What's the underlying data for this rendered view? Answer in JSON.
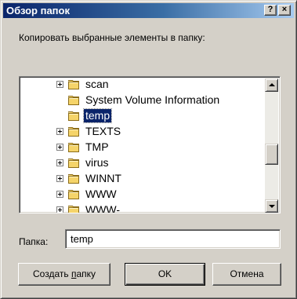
{
  "window": {
    "title": "Обзор папок",
    "help_label": "?",
    "close_label": "×"
  },
  "instruction": "Копировать выбранные элементы в папку:",
  "tree": {
    "items": [
      {
        "label": "scan",
        "has_children": true,
        "selected": false
      },
      {
        "label": "System Volume Information",
        "has_children": false,
        "selected": false
      },
      {
        "label": "temp",
        "has_children": false,
        "selected": true
      },
      {
        "label": "TEXTS",
        "has_children": true,
        "selected": false
      },
      {
        "label": "TMP",
        "has_children": true,
        "selected": false
      },
      {
        "label": "virus",
        "has_children": true,
        "selected": false
      },
      {
        "label": "WINNT",
        "has_children": true,
        "selected": false
      },
      {
        "label": "WWW",
        "has_children": true,
        "selected": false
      },
      {
        "label": "WWW-",
        "has_children": true,
        "selected": false
      }
    ],
    "scroll_position": 0.6
  },
  "folder_field": {
    "label": "Папка:",
    "value": "temp"
  },
  "buttons": {
    "create_prefix": "Создать ",
    "create_underlined": "п",
    "create_suffix": "апку",
    "ok": "OK",
    "cancel": "Отмена"
  },
  "colors": {
    "titlebar_start": "#0a246a",
    "selection": "#0a246a",
    "folder": "#f5d46a"
  }
}
